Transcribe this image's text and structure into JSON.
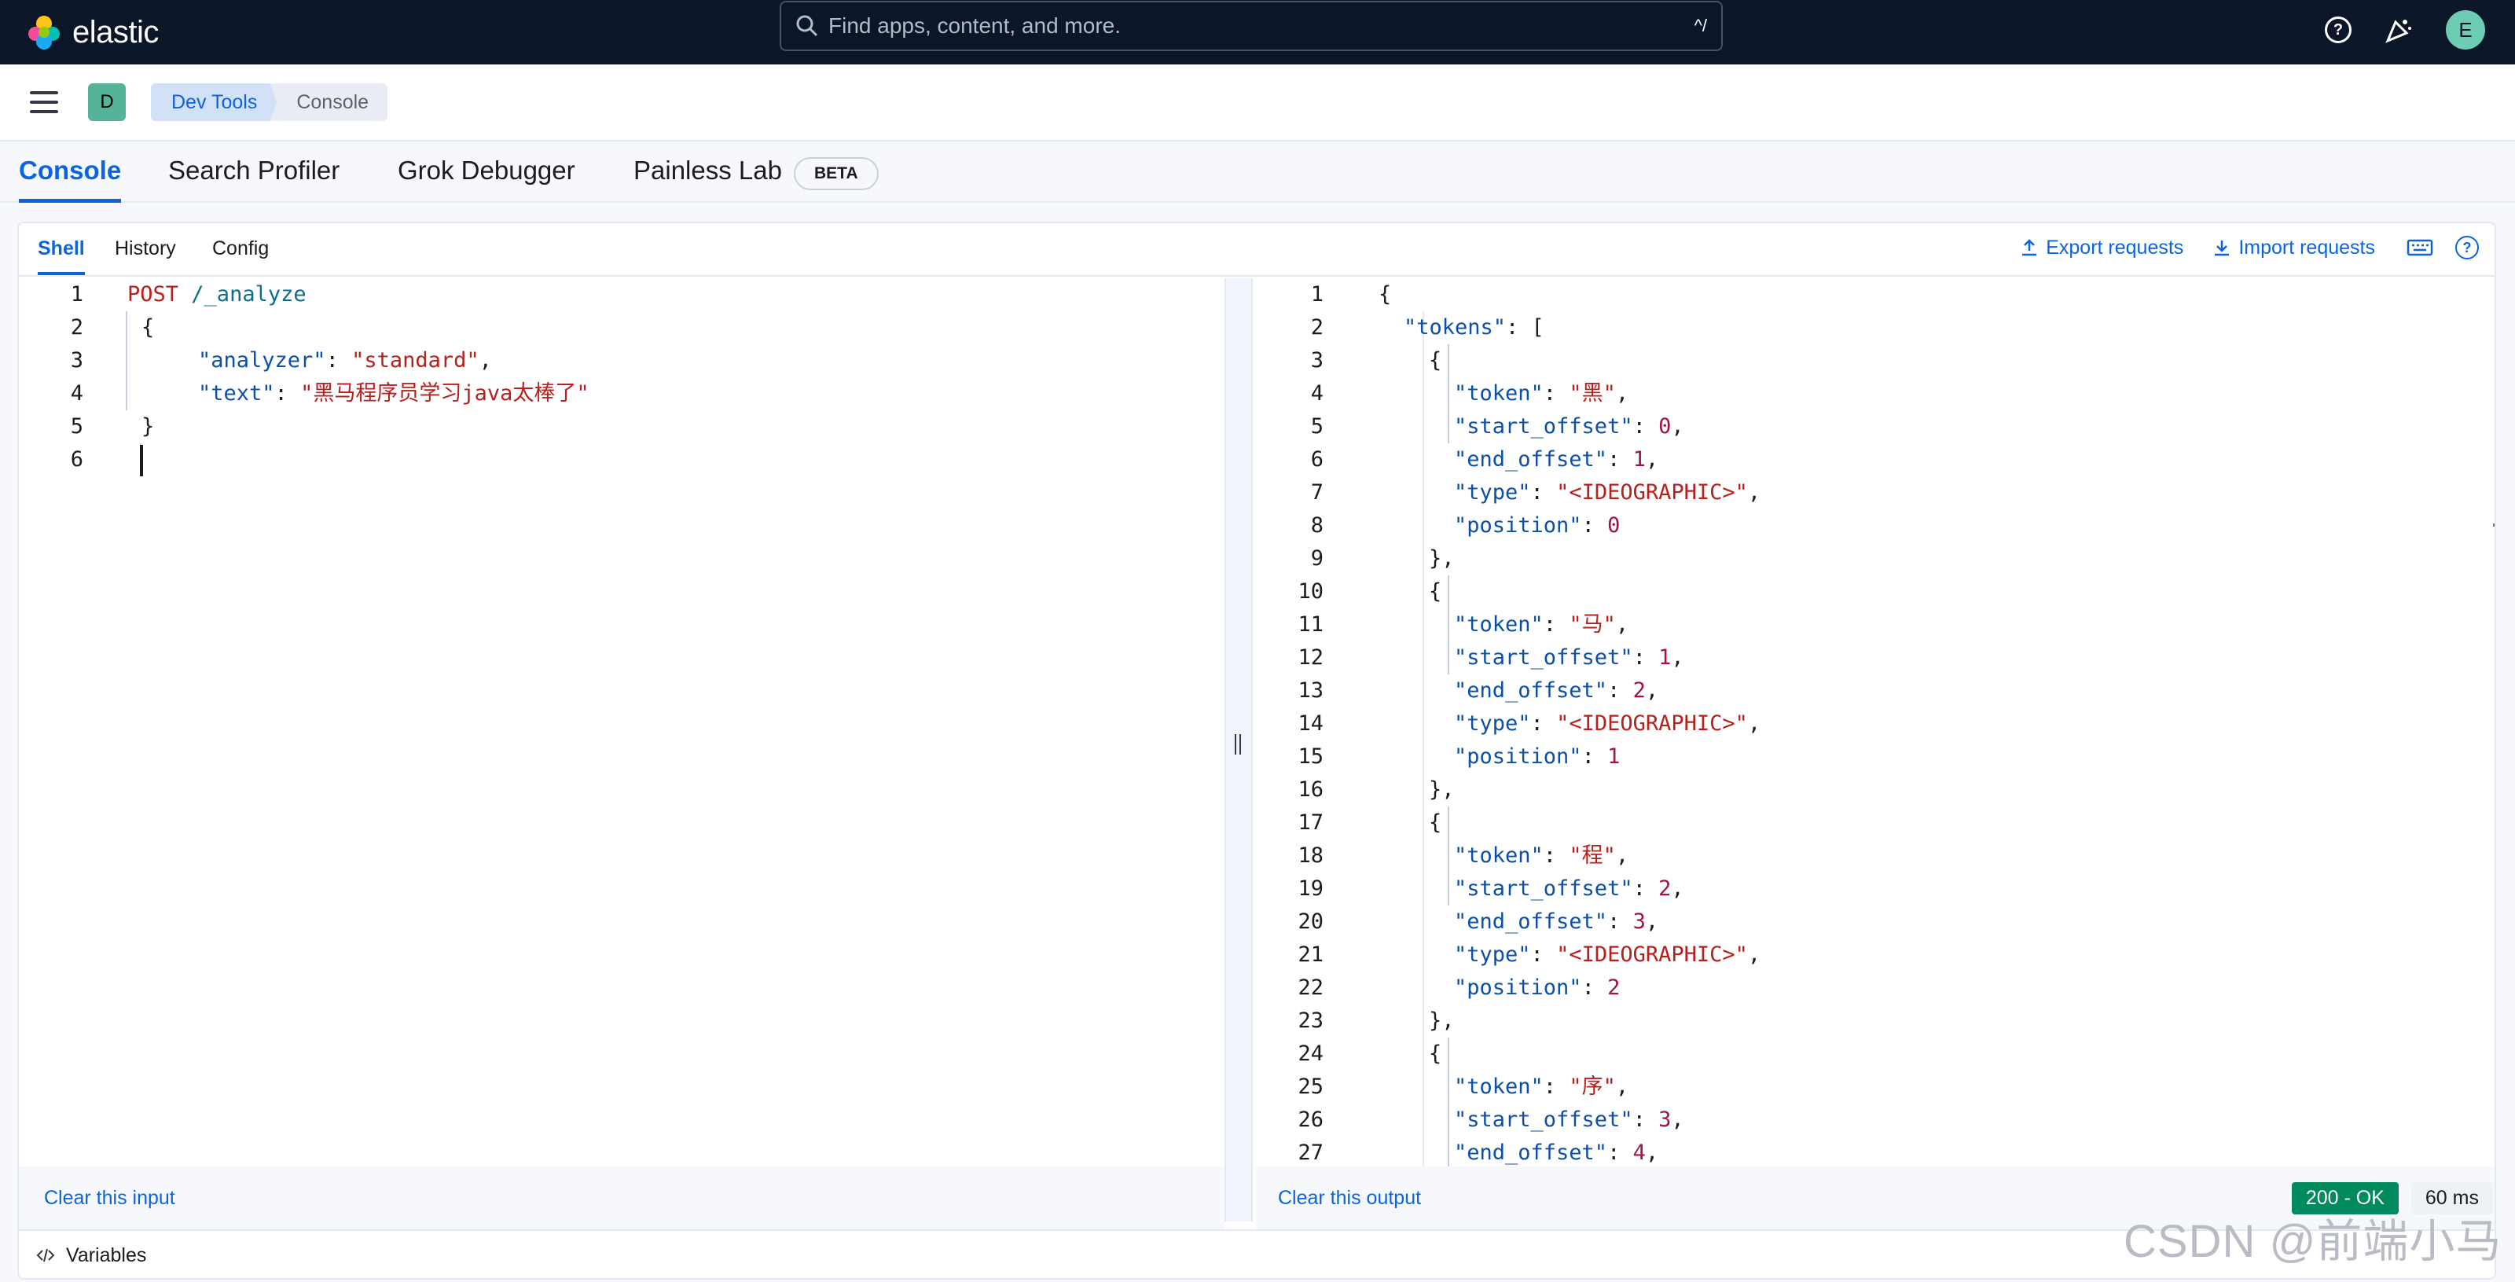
{
  "topbar": {
    "logo_text": "elastic",
    "search_placeholder": "Find apps, content, and more.",
    "search_shortcut": "^/",
    "avatar_letter": "E"
  },
  "header": {
    "space_letter": "D",
    "breadcrumb_1": "Dev Tools",
    "breadcrumb_2": "Console"
  },
  "tabs": [
    {
      "label": "Console"
    },
    {
      "label": "Search Profiler"
    },
    {
      "label": "Grok Debugger"
    },
    {
      "label": "Painless Lab"
    }
  ],
  "beta_badge": "BETA",
  "subtabs": [
    {
      "label": "Shell"
    },
    {
      "label": "History"
    },
    {
      "label": "Config"
    }
  ],
  "actions": {
    "export": "Export requests",
    "import": "Import requests"
  },
  "input": {
    "line_numbers": [
      "1",
      "2",
      "3",
      "4",
      "5",
      "6"
    ],
    "method": "POST",
    "path": "/_analyze",
    "open_brace": "{",
    "close_brace": "}",
    "analyzer_key": "\"analyzer\"",
    "analyzer_value": "\"standard\"",
    "text_key": "\"text\"",
    "text_value": "\"黑马程序员学习java太棒了\""
  },
  "output": {
    "line_numbers": [
      "1",
      "2",
      "3",
      "4",
      "5",
      "6",
      "7",
      "8",
      "9",
      "10",
      "11",
      "12",
      "13",
      "14",
      "15",
      "16",
      "17",
      "18",
      "19",
      "20",
      "21",
      "22",
      "23",
      "24",
      "25",
      "26",
      "27"
    ],
    "lines": [
      "{",
      "\"tokens\": [",
      "{",
      "\"token\": \"黑\",",
      "\"start_offset\": 0,",
      "\"end_offset\": 1,",
      "\"type\": \"<IDEOGRAPHIC>\",",
      "\"position\": 0",
      "},",
      "{",
      "\"token\": \"马\",",
      "\"start_offset\": 1,",
      "\"end_offset\": 2,",
      "\"type\": \"<IDEOGRAPHIC>\",",
      "\"position\": 1",
      "},",
      "{",
      "\"token\": \"程\",",
      "\"start_offset\": 2,",
      "\"end_offset\": 3,",
      "\"type\": \"<IDEOGRAPHIC>\",",
      "\"position\": 2",
      "},",
      "{",
      "\"token\": \"序\",",
      "\"start_offset\": 3,",
      "\"end_offset\": 4,"
    ]
  },
  "footer": {
    "clear_input": "Clear this input",
    "clear_output": "Clear this output",
    "status": "200 - OK",
    "time": "60 ms",
    "variables": "Variables"
  },
  "watermark": "CSDN @前端小马"
}
